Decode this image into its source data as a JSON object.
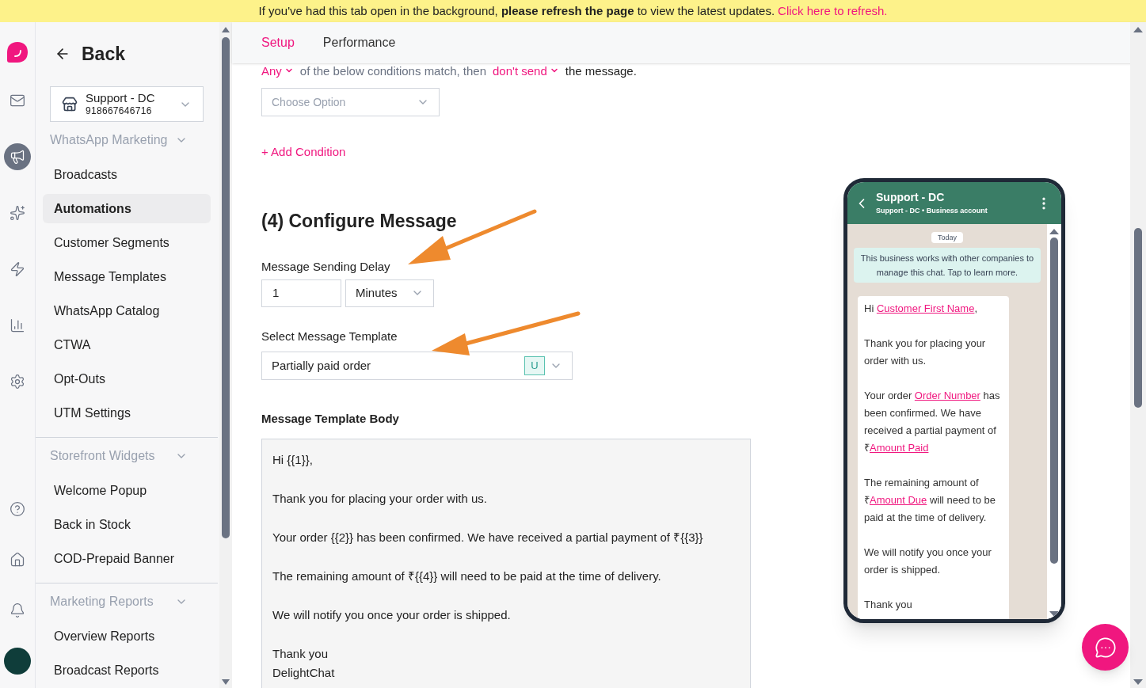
{
  "banner": {
    "text": "If you've had this tab open in the background, **please refresh the page** to view the latest updates.",
    "link": "Click here to refresh."
  },
  "rail": {
    "top": [
      {
        "kind": "logo",
        "selected": false
      },
      {
        "kind": "mail",
        "selected": false
      },
      {
        "kind": "megaphone",
        "selected": true
      },
      {
        "kind": "sparkles",
        "selected": false
      },
      {
        "kind": "zap",
        "selected": false
      },
      {
        "kind": "chart",
        "selected": false
      },
      {
        "kind": "settings",
        "selected": false
      }
    ],
    "bottom": [
      {
        "kind": "help"
      },
      {
        "kind": "home"
      },
      {
        "kind": "bell"
      },
      {
        "kind": "avatar"
      }
    ]
  },
  "sidebar": {
    "back": "Back",
    "account": {
      "name": "Support - DC",
      "phone": "918667646716"
    },
    "groups": [
      {
        "title": "WhatsApp Marketing",
        "expanded": true,
        "items": [
          {
            "label": "Broadcasts",
            "selected": false
          },
          {
            "label": "Automations",
            "selected": true
          },
          {
            "label": "Customer Segments",
            "selected": false
          },
          {
            "label": "Message Templates",
            "selected": false
          },
          {
            "label": "WhatsApp Catalog",
            "selected": false
          },
          {
            "label": "CTWA",
            "selected": false
          },
          {
            "label": "Opt-Outs",
            "selected": false
          },
          {
            "label": "UTM Settings",
            "selected": false
          }
        ]
      },
      {
        "title": "Storefront Widgets",
        "expanded": true,
        "items": [
          {
            "label": "Welcome Popup",
            "selected": false
          },
          {
            "label": "Back in Stock",
            "selected": false
          },
          {
            "label": "COD-Prepaid Banner",
            "selected": false
          }
        ]
      },
      {
        "title": "Marketing Reports",
        "expanded": true,
        "items": [
          {
            "label": "Overview Reports",
            "selected": false
          },
          {
            "label": "Broadcast Reports",
            "selected": false
          }
        ]
      }
    ]
  },
  "tabs": [
    {
      "label": "Setup",
      "selected": true
    },
    {
      "label": "Performance",
      "selected": false
    }
  ],
  "condition": {
    "match": "Any",
    "middle": "of the below conditions match, then",
    "action": "don't send",
    "end": "the message.",
    "select_placeholder": "Choose Option",
    "add": "+ Add Condition"
  },
  "configure": {
    "heading": "(4) Configure Message",
    "delay_label": "Message Sending Delay",
    "delay_value": "1",
    "delay_unit": "Minutes",
    "template_label": "Select Message Template",
    "template_value": "Partially paid order",
    "template_badge": "U",
    "body_label": "Message Template Body",
    "body": [
      "Hi {{1}},",
      "Thank you for placing your order with us.",
      "Your order {{2}} has been confirmed. We have received a partial payment of ₹{{3}}",
      "The remaining amount of ₹{{4}} will need to be paid at the time of delivery.",
      "We will notify you once your order is shipped.",
      "Thank you\nDelightChat"
    ]
  },
  "preview": {
    "title": "Support - DC",
    "subtitle": "Support - DC • Business account",
    "date": "Today",
    "notice": "This business works with other companies to manage this chat. Tap to learn more.",
    "paragraphs": [
      [
        {
          "kind": "text",
          "text": "Hi "
        },
        {
          "kind": "variable",
          "text": "Customer First Name"
        },
        {
          "kind": "text",
          "text": ","
        }
      ],
      [
        {
          "kind": "text",
          "text": "Thank you for placing your order with us."
        }
      ],
      [
        {
          "kind": "text",
          "text": "Your order "
        },
        {
          "kind": "variable",
          "text": "Order Number"
        },
        {
          "kind": "text",
          "text": " has been confirmed. We have received a partial payment of ₹"
        },
        {
          "kind": "variable",
          "text": "Amount Paid"
        }
      ],
      [
        {
          "kind": "text",
          "text": "The remaining amount of ₹"
        },
        {
          "kind": "variable",
          "text": "Amount Due"
        },
        {
          "kind": "text",
          "text": " will need to be paid at the time of delivery."
        }
      ],
      [
        {
          "kind": "text",
          "text": "We will notify you once your order is shipped."
        }
      ],
      [
        {
          "kind": "text",
          "text": "Thank you"
        }
      ]
    ]
  }
}
